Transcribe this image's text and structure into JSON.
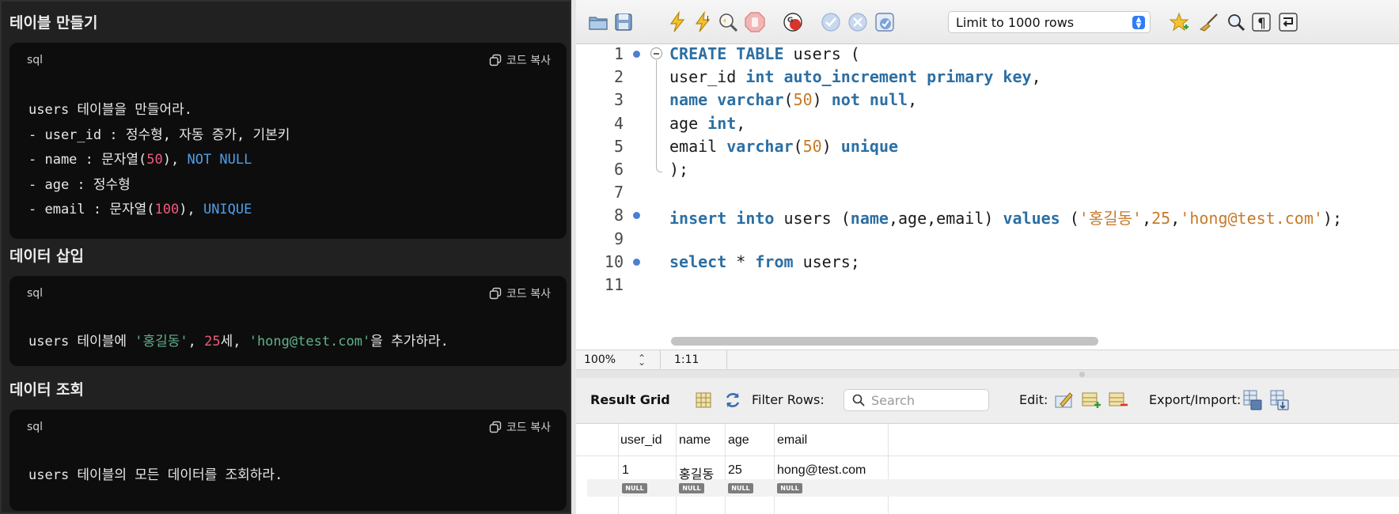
{
  "left": {
    "sections": [
      {
        "title": "테이블 만들기",
        "lang": "sql",
        "copy_label": "코드 복사",
        "lines": [
          [
            {
              "t": "users 테이블을 만들어라."
            }
          ],
          [
            {
              "t": "- user_id : 정수형, 자동 증가, 기본키"
            }
          ],
          [
            {
              "t": "- name : 문자열("
            },
            {
              "t": "50",
              "c": "num"
            },
            {
              "t": "), "
            },
            {
              "t": "NOT NULL",
              "c": "kw"
            }
          ],
          [
            {
              "t": "- age : 정수형"
            }
          ],
          [
            {
              "t": "- email : 문자열("
            },
            {
              "t": "100",
              "c": "num"
            },
            {
              "t": "), "
            },
            {
              "t": "UNIQUE",
              "c": "kw"
            }
          ]
        ]
      },
      {
        "title": "데이터 삽입",
        "lang": "sql",
        "copy_label": "코드 복사",
        "lines": [
          [
            {
              "t": "users 테이블에 "
            },
            {
              "t": "'홍길동'",
              "c": "str"
            },
            {
              "t": ", "
            },
            {
              "t": "25",
              "c": "num"
            },
            {
              "t": "세, "
            },
            {
              "t": "'hong@test.com'",
              "c": "str"
            },
            {
              "t": "을 추가하라."
            }
          ]
        ]
      },
      {
        "title": "데이터 조회",
        "lang": "sql",
        "copy_label": "코드 복사",
        "lines": [
          [
            {
              "t": "users 테이블의 모든 데이터를 조회하라."
            }
          ]
        ]
      }
    ]
  },
  "toolbar": {
    "limit_select": "Limit to 1000 rows",
    "icons": [
      "open-folder-icon",
      "save-icon",
      "execute-icon",
      "execute-current-icon",
      "explain-icon",
      "stop-icon",
      "toggle-error-icon",
      "commit-icon",
      "rollback-icon",
      "autocommit-icon",
      "bookmark-icon",
      "beautify-icon",
      "find-icon",
      "invisible-chars-icon",
      "wrap-icon"
    ]
  },
  "editor": {
    "lines": [
      {
        "no": "1",
        "dot": true,
        "fold": true,
        "tokens": [
          {
            "t": "CREATE TABLE",
            "c": "k"
          },
          {
            "t": " users ("
          }
        ]
      },
      {
        "no": "2",
        "dot": false,
        "tokens": [
          {
            "t": "user_id "
          },
          {
            "t": "int auto_increment primary key",
            "c": "k"
          },
          {
            "t": ","
          }
        ]
      },
      {
        "no": "3",
        "dot": false,
        "tokens": [
          {
            "t": "name",
            "c": "k"
          },
          {
            "t": " "
          },
          {
            "t": "varchar",
            "c": "k"
          },
          {
            "t": "("
          },
          {
            "t": "50",
            "c": "n"
          },
          {
            "t": ") "
          },
          {
            "t": "not null",
            "c": "k"
          },
          {
            "t": ","
          }
        ]
      },
      {
        "no": "4",
        "dot": false,
        "tokens": [
          {
            "t": "age "
          },
          {
            "t": "int",
            "c": "k"
          },
          {
            "t": ","
          }
        ]
      },
      {
        "no": "5",
        "dot": false,
        "tokens": [
          {
            "t": "email "
          },
          {
            "t": "varchar",
            "c": "k"
          },
          {
            "t": "("
          },
          {
            "t": "50",
            "c": "n"
          },
          {
            "t": ") "
          },
          {
            "t": "unique",
            "c": "k"
          }
        ]
      },
      {
        "no": "6",
        "dot": false,
        "tokens": [
          {
            "t": ");"
          }
        ]
      },
      {
        "no": "7",
        "dot": false,
        "tokens": []
      },
      {
        "no": "8",
        "dot": true,
        "tokens": [
          {
            "t": "insert into",
            "c": "k"
          },
          {
            "t": " users ("
          },
          {
            "t": "name",
            "c": "k"
          },
          {
            "t": ",age,email) "
          },
          {
            "t": "values",
            "c": "k"
          },
          {
            "t": " ("
          },
          {
            "t": "'홍길동'",
            "c": "s"
          },
          {
            "t": ","
          },
          {
            "t": "25",
            "c": "n"
          },
          {
            "t": ","
          },
          {
            "t": "'hong@test.com'",
            "c": "s"
          },
          {
            "t": ");"
          }
        ]
      },
      {
        "no": "9",
        "dot": false,
        "tokens": []
      },
      {
        "no": "10",
        "dot": true,
        "tokens": [
          {
            "t": "select",
            "c": "k"
          },
          {
            "t": " * "
          },
          {
            "t": "from",
            "c": "k"
          },
          {
            "t": " users;"
          }
        ]
      },
      {
        "no": "11",
        "dot": false,
        "tokens": []
      }
    ]
  },
  "status": {
    "zoom": "100%",
    "cursor": "1:11"
  },
  "result": {
    "label": "Result Grid",
    "filter_label": "Filter Rows:",
    "search_placeholder": "Search",
    "edit_label": "Edit:",
    "export_label": "Export/Import:",
    "columns": [
      "user_id",
      "name",
      "age",
      "email"
    ],
    "rows": [
      [
        "1",
        "홍길동",
        "25",
        "hong@test.com"
      ]
    ],
    "null_label": "NULL"
  }
}
